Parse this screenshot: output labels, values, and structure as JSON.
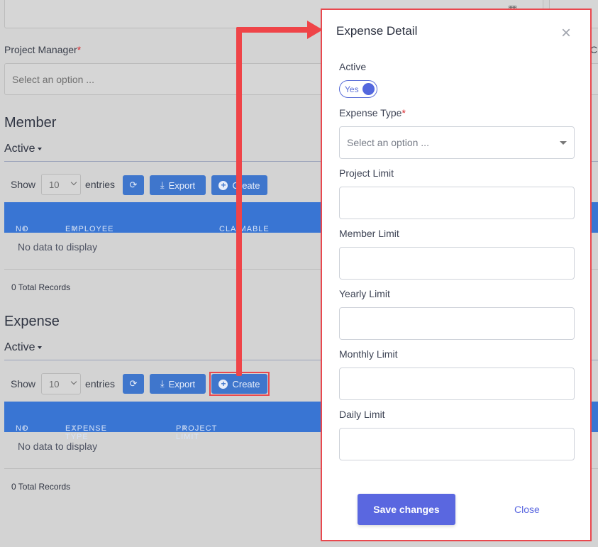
{
  "background": {
    "project_manager_label": "Project Manager",
    "required_mark": "*",
    "project_manager_placeholder": "Select an option ...",
    "member": {
      "title": "Member",
      "status_filter": "Active",
      "show_label": "Show",
      "entries_value": "10",
      "entries_label": "entries",
      "export_label": "Export",
      "create_label": "Create",
      "columns": [
        "NO",
        "EMPLOYEE",
        "CLAIMABLE"
      ],
      "empty_text": "No data to display",
      "total_text": "0 Total Records"
    },
    "expense": {
      "title": "Expense",
      "status_filter": "Active",
      "show_label": "Show",
      "entries_value": "10",
      "entries_label": "entries",
      "export_label": "Export",
      "create_label": "Create",
      "columns": [
        "NO",
        "EXPENSE TYPE",
        "PROJECT LIMIT"
      ],
      "empty_text": "No data to display",
      "total_text": "0 Total Records"
    }
  },
  "modal": {
    "title": "Expense Detail",
    "close_symbol": "×",
    "active_label": "Active",
    "active_toggle_text": "Yes",
    "expense_type_label": "Expense Type",
    "required_mark": "*",
    "expense_type_placeholder": "Select an option ...",
    "project_limit_label": "Project Limit",
    "member_limit_label": "Member Limit",
    "yearly_limit_label": "Yearly Limit",
    "monthly_limit_label": "Monthly Limit",
    "daily_limit_label": "Daily Limit",
    "save_label": "Save changes",
    "close_label": "Close"
  },
  "colors": {
    "accent": "#5a67e0",
    "table_header": "#3975d3",
    "highlight": "#e9484e"
  }
}
